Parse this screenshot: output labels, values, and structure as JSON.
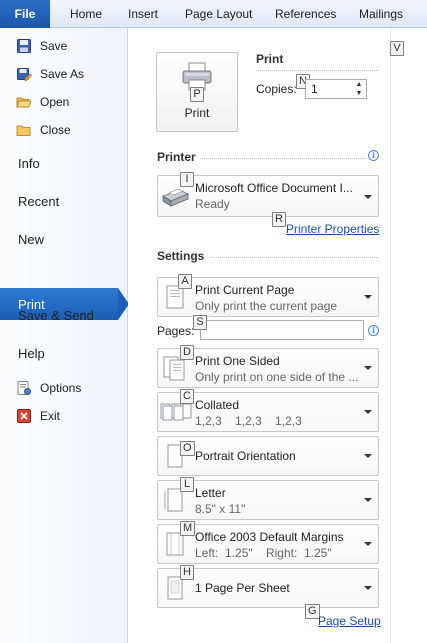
{
  "ribbon": {
    "file_tab": "File",
    "tabs": [
      "Home",
      "Insert",
      "Page Layout",
      "References",
      "Mailings"
    ]
  },
  "nav": {
    "save": "Save",
    "save_as": "Save As",
    "open": "Open",
    "close": "Close",
    "info": "Info",
    "recent": "Recent",
    "new": "New",
    "print": "Print",
    "save_send": "Save & Send",
    "help": "Help",
    "options": "Options",
    "exit": "Exit"
  },
  "keytips": {
    "collapse": "V",
    "print_button": "P",
    "copies": "N",
    "printer": "I",
    "printer_properties": "R",
    "print_what": "A",
    "pages": "S",
    "sides": "D",
    "collation": "C",
    "orientation": "O",
    "paper": "L",
    "margins": "M",
    "per_sheet": "H",
    "page_setup": "G"
  },
  "print": {
    "section_title": "Print",
    "button_label": "Print",
    "copies_label": "Copies:",
    "copies_value": "1"
  },
  "printer": {
    "header": "Printer",
    "name": "Microsoft Office Document I...",
    "status": "Ready",
    "properties_link": "Printer Properties"
  },
  "settings": {
    "header": "Settings",
    "print_what_title": "Print Current Page",
    "print_what_desc": "Only print the current page",
    "pages_label": "Pages:",
    "pages_value": "",
    "sides_title": "Print One Sided",
    "sides_desc": "Only print on one side of the ...",
    "collation_title": "Collated",
    "collation_desc": "1,2,3    1,2,3    1,2,3",
    "orientation_title": "Portrait Orientation",
    "paper_title": "Letter",
    "paper_desc": "8.5\" x 11\"",
    "margins_title": "Office 2003 Default Margins",
    "margins_desc": "Left:  1.25\"    Right:  1.25\"",
    "per_sheet_title": "1 Page Per Sheet",
    "page_setup_link": "Page Setup"
  },
  "colors": {
    "accent": "#1a5eb5",
    "link": "#1a4f9c"
  }
}
